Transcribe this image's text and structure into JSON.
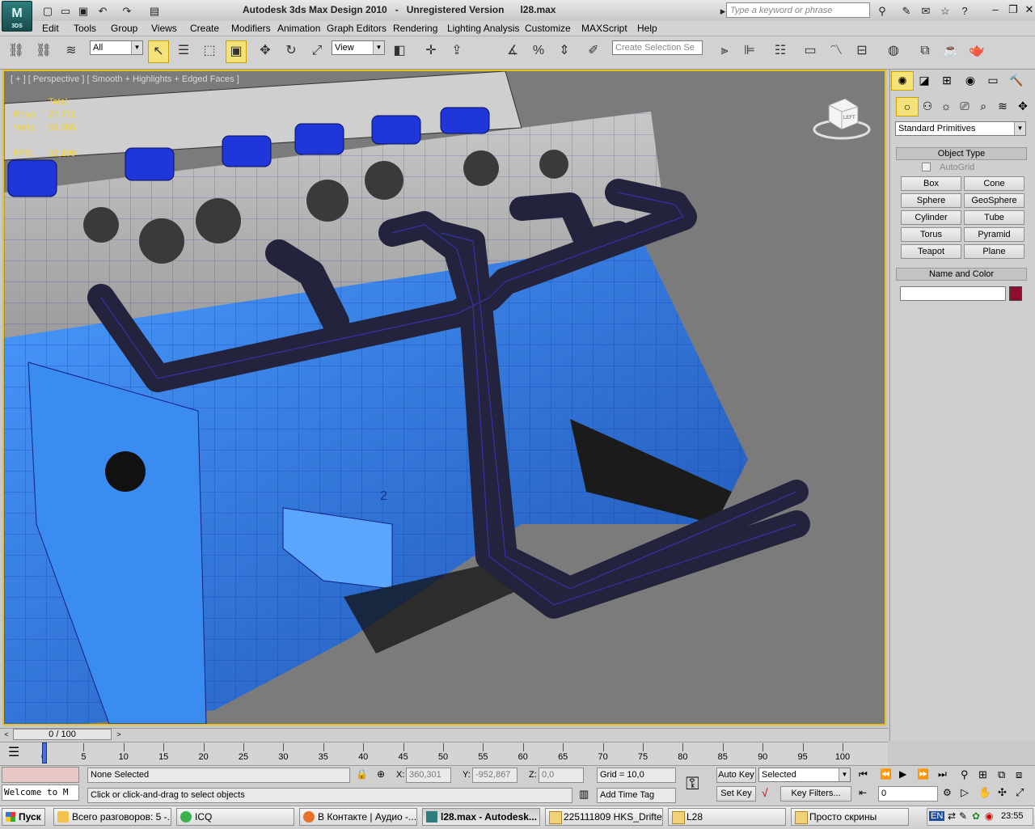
{
  "app": {
    "logo_text": "3DS",
    "title": "Autodesk 3ds Max Design 2010   -   Unregistered Version      l28.max",
    "search_placeholder": "Type a keyword or phrase"
  },
  "menu": [
    "Edit",
    "Tools",
    "Group",
    "Views",
    "Create",
    "Modifiers",
    "Animation",
    "Graph Editors",
    "Rendering",
    "Lighting Analysis",
    "Customize",
    "MAXScript",
    "Help"
  ],
  "toolbar": {
    "filter_value": "All",
    "refcoord_value": "View",
    "selection_set_placeholder": "Create Selection Se"
  },
  "viewport": {
    "label": "[ + ] [ Perspective ] [ Smooth + Highlights + Edged Faces ]",
    "stats": {
      "total_label": "Total",
      "polys_label": "Polys:",
      "polys_value": "70 771",
      "verts_label": "Verts:",
      "verts_value": "59 355",
      "fps_label": "FPS:",
      "fps_value": "32,199"
    },
    "viewcube_label": "LEFT"
  },
  "command_panel": {
    "category_value": "Standard Primitives",
    "object_type_title": "Object Type",
    "autogrid_label": "AutoGrid",
    "primitives": [
      "Box",
      "Cone",
      "Sphere",
      "GeoSphere",
      "Cylinder",
      "Tube",
      "Torus",
      "Pyramid",
      "Teapot",
      "Plane"
    ],
    "name_color_title": "Name and Color",
    "name_value": "",
    "object_color": "#8f0e2f"
  },
  "timeline": {
    "slider_text": "0 / 100",
    "ticks": [
      "0",
      "5",
      "10",
      "15",
      "20",
      "25",
      "30",
      "35",
      "40",
      "45",
      "50",
      "55",
      "60",
      "65",
      "70",
      "75",
      "80",
      "85",
      "90",
      "95",
      "100"
    ]
  },
  "status": {
    "maxscript_listener": "Welcome to M",
    "selection": "None Selected",
    "prompt": "Click or click-and-drag to select objects",
    "x_label": "X:",
    "x_value": "360,301",
    "y_label": "Y:",
    "y_value": "-952,867",
    "z_label": "Z:",
    "z_value": "0,0",
    "grid": "Grid = 10,0",
    "add_time_tag": "Add Time Tag",
    "auto_key": "Auto Key",
    "set_key": "Set Key",
    "key_mode_value": "Selected",
    "key_filters": "Key Filters...",
    "frame_value": "0"
  },
  "taskbar": {
    "start": "Пуск",
    "items": [
      {
        "label": "Всего разговоров: 5 -...",
        "active": false
      },
      {
        "label": "ICQ",
        "active": false
      },
      {
        "label": "В Контакте | Аудио -...",
        "active": false
      },
      {
        "label": "l28.max - Autodesk...",
        "active": true
      },
      {
        "label": "225111809 HKS_Drifter",
        "active": false
      },
      {
        "label": "L28",
        "active": false
      },
      {
        "label": "Просто скрины",
        "active": false
      }
    ],
    "lang": "EN",
    "clock": "23:55"
  },
  "colors": {
    "viewport_bg": "#7b7b7b",
    "active_border": "#e8c21a",
    "mesh_blue": "#2d6fd9",
    "tube_dark": "#22223a",
    "stat_yellow": "#f3d22a"
  }
}
